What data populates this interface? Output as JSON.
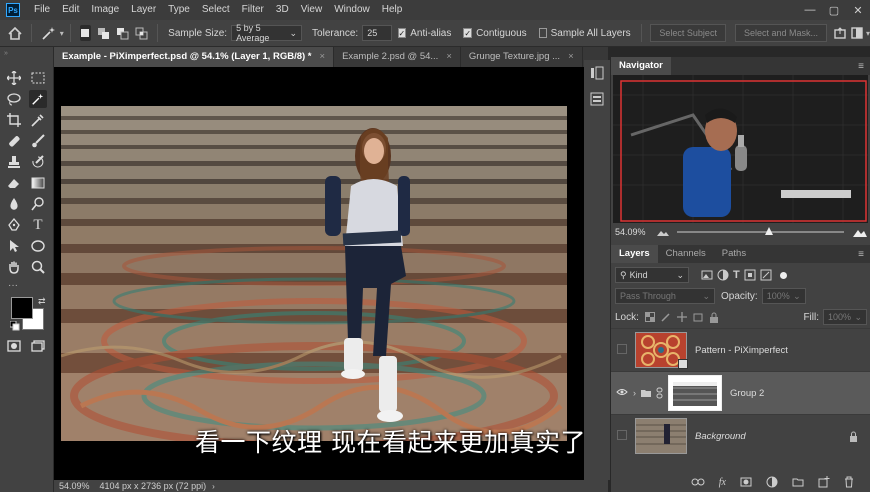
{
  "menubar": {
    "logo": "Ps",
    "items": [
      "File",
      "Edit",
      "Image",
      "Layer",
      "Type",
      "Select",
      "Filter",
      "3D",
      "View",
      "Window",
      "Help"
    ],
    "window_controls": [
      "—",
      "▢",
      "✕"
    ]
  },
  "options": {
    "sample_size_label": "Sample Size:",
    "sample_size_value": "5 by 5 Average",
    "tolerance_label": "Tolerance:",
    "tolerance_value": "25",
    "anti_alias_label": "Anti-alias",
    "contiguous_label": "Contiguous",
    "sample_all_layers_label": "Sample All Layers",
    "select_subject_label": "Select Subject",
    "select_mask_label": "Select and Mask..."
  },
  "tabs": [
    {
      "label": "Example - PiXimperfect.psd @ 54.1% (Layer 1, RGB/8) *",
      "close": "×"
    },
    {
      "label": "Example 2.psd @ 54...",
      "close": "×"
    },
    {
      "label": "Grunge Texture.jpg ...",
      "close": "×"
    }
  ],
  "status": {
    "zoom": "54.09%",
    "doc_info": "4104 px x 2736 px (72 ppi)"
  },
  "subtitle": "看一下纹理 现在看起来更加真实了",
  "navigator": {
    "title": "Navigator",
    "zoom": "54.09%"
  },
  "layers_panel": {
    "tabs": [
      "Layers",
      "Channels",
      "Paths"
    ],
    "kind_label": "Kind",
    "blend_mode": "Pass Through",
    "opacity_label": "Opacity:",
    "opacity_value": "100%",
    "lock_label": "Lock:",
    "fill_label": "Fill:",
    "fill_value": "100%",
    "layers": [
      {
        "name": "Pattern - PiXimperfect"
      },
      {
        "name": "Group 2"
      },
      {
        "name": "Background"
      }
    ]
  },
  "colors": {
    "accent": "#31a8ff",
    "panel": "#424242",
    "canvas": "#000000"
  }
}
